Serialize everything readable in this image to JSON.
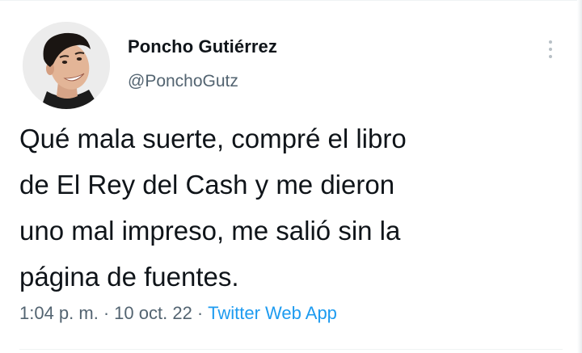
{
  "user": {
    "display_name": "Poncho Gutiérrez",
    "handle": "@PonchoGutz",
    "avatar_icon": "profile-photo"
  },
  "tweet": {
    "lines": [
      "Qué mala suerte, compré el libro",
      "de El Rey del Cash y me dieron",
      "uno mal impreso, me salió sin la",
      "página de fuentes."
    ],
    "time": "1:04 p. m.",
    "separator": "·",
    "date": "10 oct. 22",
    "source": "Twitter Web App"
  },
  "menu": {
    "icon": "more-vertical-icon"
  },
  "colors": {
    "text": "#0f1419",
    "secondary": "#536471",
    "link": "#1d9bf0"
  }
}
